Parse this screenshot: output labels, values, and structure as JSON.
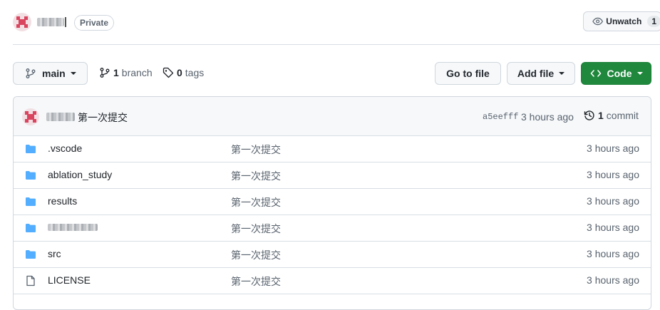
{
  "repo": {
    "visibility": "Private",
    "unwatch_label": "Unwatch",
    "watch_count": "1"
  },
  "toolbar": {
    "branch_name": "main",
    "branch_count": "1",
    "branch_label": "branch",
    "tag_count": "0",
    "tag_label": "tags",
    "goto_file": "Go to file",
    "add_file": "Add file",
    "code": "Code"
  },
  "latest_commit": {
    "message": "第一次提交",
    "sha": "a5eefff",
    "time": "3 hours ago",
    "commit_count": "1",
    "commit_label": "commit"
  },
  "files": [
    {
      "type": "folder",
      "name": ".vscode",
      "message": "第一次提交",
      "time": "3 hours ago"
    },
    {
      "type": "folder",
      "name": "ablation_study",
      "message": "第一次提交",
      "time": "3 hours ago"
    },
    {
      "type": "folder",
      "name": "results",
      "message": "第一次提交",
      "time": "3 hours ago"
    },
    {
      "type": "folder",
      "name": "",
      "message": "第一次提交",
      "time": "3 hours ago"
    },
    {
      "type": "folder",
      "name": "src",
      "message": "第一次提交",
      "time": "3 hours ago"
    },
    {
      "type": "file",
      "name": "LICENSE",
      "message": "第一次提交",
      "time": "3 hours ago"
    }
  ],
  "colors": {
    "code_button": "#1f883d",
    "folder_icon": "#54aeff",
    "avatar": "#d9445f"
  }
}
